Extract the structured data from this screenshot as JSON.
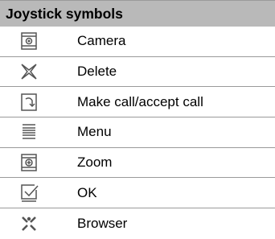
{
  "table": {
    "title": "Joystick symbols",
    "rows": [
      {
        "icon": "camera-icon",
        "label": "Camera"
      },
      {
        "icon": "delete-icon",
        "label": "Delete"
      },
      {
        "icon": "make-call-icon",
        "label": "Make call/accept call"
      },
      {
        "icon": "menu-icon",
        "label": "Menu"
      },
      {
        "icon": "zoom-icon",
        "label": "Zoom"
      },
      {
        "icon": "ok-icon",
        "label": "OK"
      },
      {
        "icon": "browser-icon",
        "label": "Browser"
      }
    ]
  }
}
